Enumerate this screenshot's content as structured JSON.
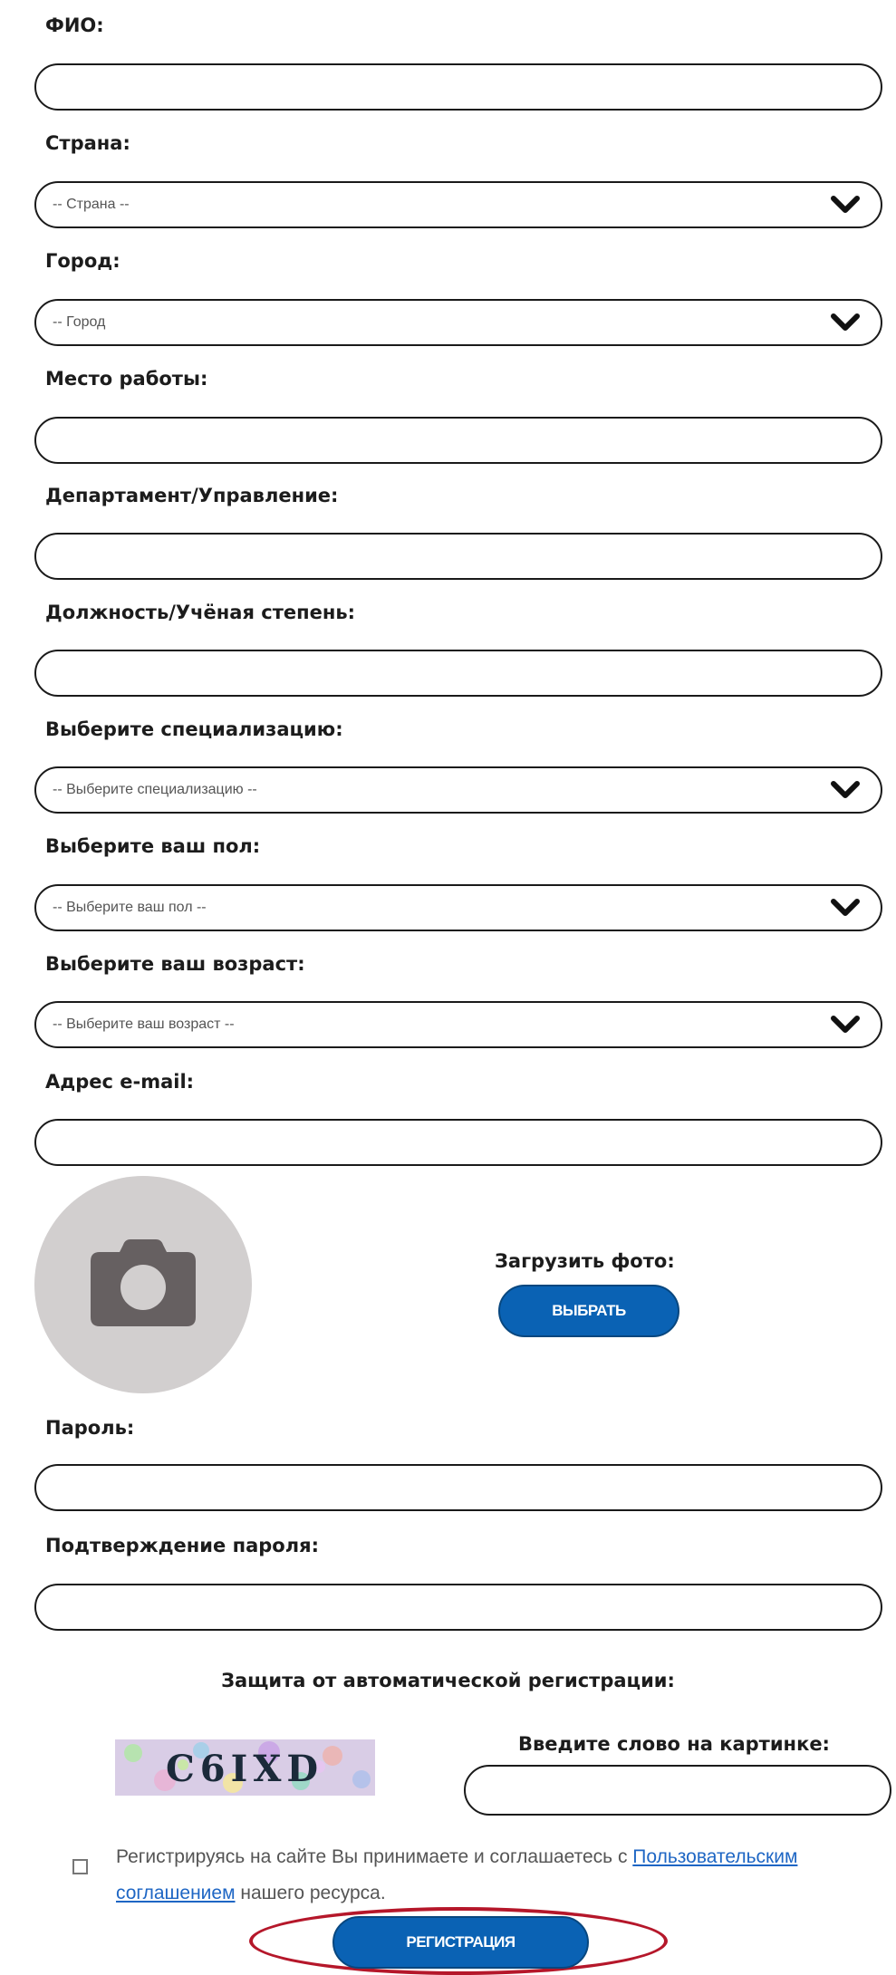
{
  "form": {
    "fio_label": "ФИО:",
    "country_label": "Страна:",
    "country_value": "-- Страна --",
    "city_label": "Город:",
    "city_value": "-- Город",
    "workplace_label": "Место работы:",
    "department_label": "Департамент/Управление:",
    "position_label": "Должность/Учёная степень:",
    "specialization_label": "Выберите специализацию:",
    "specialization_value": "-- Выберите специализацию --",
    "gender_label": "Выберите ваш пол:",
    "gender_value": "-- Выберите ваш пол --",
    "age_label": "Выберите ваш возраст:",
    "age_value": "-- Выберите ваш возраст --",
    "email_label": "Адрес e-mail:",
    "upload_label": "Загрузить фото:",
    "choose_button": "ВЫБРАТЬ",
    "password_label": "Пароль:",
    "password_confirm_label": "Подтверждение пароля:"
  },
  "captcha": {
    "section_title": "Защита от автоматической регистрации:",
    "image_text": "C6IXD",
    "hint": "Введите слово на картинке:"
  },
  "agreement": {
    "text_before": "Регистрируясь на сайте Вы принимаете и соглашаетесь с ",
    "link_text": "Пользовательским соглашением",
    "text_after": " нашего ресурса."
  },
  "register_button": "РЕГИСТРАЦИЯ",
  "icons": {
    "chevron": "chevron-down-icon",
    "camera": "camera-icon"
  },
  "colors": {
    "accent": "#0a62b4",
    "link": "#1e66c4",
    "highlight": "#b5172a",
    "avatar_bg": "#d2cfcf"
  }
}
